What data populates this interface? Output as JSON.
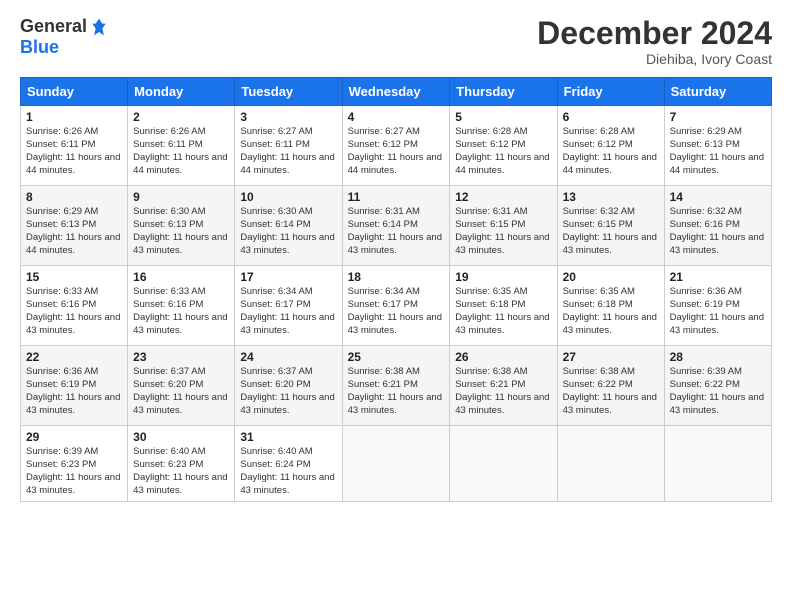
{
  "header": {
    "logo_general": "General",
    "logo_blue": "Blue",
    "title": "December 2024",
    "location": "Diehiba, Ivory Coast"
  },
  "weekdays": [
    "Sunday",
    "Monday",
    "Tuesday",
    "Wednesday",
    "Thursday",
    "Friday",
    "Saturday"
  ],
  "weeks": [
    [
      {
        "day": "1",
        "sunrise": "6:26 AM",
        "sunset": "6:11 PM",
        "daylight": "11 hours and 44 minutes."
      },
      {
        "day": "2",
        "sunrise": "6:26 AM",
        "sunset": "6:11 PM",
        "daylight": "11 hours and 44 minutes."
      },
      {
        "day": "3",
        "sunrise": "6:27 AM",
        "sunset": "6:11 PM",
        "daylight": "11 hours and 44 minutes."
      },
      {
        "day": "4",
        "sunrise": "6:27 AM",
        "sunset": "6:12 PM",
        "daylight": "11 hours and 44 minutes."
      },
      {
        "day": "5",
        "sunrise": "6:28 AM",
        "sunset": "6:12 PM",
        "daylight": "11 hours and 44 minutes."
      },
      {
        "day": "6",
        "sunrise": "6:28 AM",
        "sunset": "6:12 PM",
        "daylight": "11 hours and 44 minutes."
      },
      {
        "day": "7",
        "sunrise": "6:29 AM",
        "sunset": "6:13 PM",
        "daylight": "11 hours and 44 minutes."
      }
    ],
    [
      {
        "day": "8",
        "sunrise": "6:29 AM",
        "sunset": "6:13 PM",
        "daylight": "11 hours and 44 minutes."
      },
      {
        "day": "9",
        "sunrise": "6:30 AM",
        "sunset": "6:13 PM",
        "daylight": "11 hours and 43 minutes."
      },
      {
        "day": "10",
        "sunrise": "6:30 AM",
        "sunset": "6:14 PM",
        "daylight": "11 hours and 43 minutes."
      },
      {
        "day": "11",
        "sunrise": "6:31 AM",
        "sunset": "6:14 PM",
        "daylight": "11 hours and 43 minutes."
      },
      {
        "day": "12",
        "sunrise": "6:31 AM",
        "sunset": "6:15 PM",
        "daylight": "11 hours and 43 minutes."
      },
      {
        "day": "13",
        "sunrise": "6:32 AM",
        "sunset": "6:15 PM",
        "daylight": "11 hours and 43 minutes."
      },
      {
        "day": "14",
        "sunrise": "6:32 AM",
        "sunset": "6:16 PM",
        "daylight": "11 hours and 43 minutes."
      }
    ],
    [
      {
        "day": "15",
        "sunrise": "6:33 AM",
        "sunset": "6:16 PM",
        "daylight": "11 hours and 43 minutes."
      },
      {
        "day": "16",
        "sunrise": "6:33 AM",
        "sunset": "6:16 PM",
        "daylight": "11 hours and 43 minutes."
      },
      {
        "day": "17",
        "sunrise": "6:34 AM",
        "sunset": "6:17 PM",
        "daylight": "11 hours and 43 minutes."
      },
      {
        "day": "18",
        "sunrise": "6:34 AM",
        "sunset": "6:17 PM",
        "daylight": "11 hours and 43 minutes."
      },
      {
        "day": "19",
        "sunrise": "6:35 AM",
        "sunset": "6:18 PM",
        "daylight": "11 hours and 43 minutes."
      },
      {
        "day": "20",
        "sunrise": "6:35 AM",
        "sunset": "6:18 PM",
        "daylight": "11 hours and 43 minutes."
      },
      {
        "day": "21",
        "sunrise": "6:36 AM",
        "sunset": "6:19 PM",
        "daylight": "11 hours and 43 minutes."
      }
    ],
    [
      {
        "day": "22",
        "sunrise": "6:36 AM",
        "sunset": "6:19 PM",
        "daylight": "11 hours and 43 minutes."
      },
      {
        "day": "23",
        "sunrise": "6:37 AM",
        "sunset": "6:20 PM",
        "daylight": "11 hours and 43 minutes."
      },
      {
        "day": "24",
        "sunrise": "6:37 AM",
        "sunset": "6:20 PM",
        "daylight": "11 hours and 43 minutes."
      },
      {
        "day": "25",
        "sunrise": "6:38 AM",
        "sunset": "6:21 PM",
        "daylight": "11 hours and 43 minutes."
      },
      {
        "day": "26",
        "sunrise": "6:38 AM",
        "sunset": "6:21 PM",
        "daylight": "11 hours and 43 minutes."
      },
      {
        "day": "27",
        "sunrise": "6:38 AM",
        "sunset": "6:22 PM",
        "daylight": "11 hours and 43 minutes."
      },
      {
        "day": "28",
        "sunrise": "6:39 AM",
        "sunset": "6:22 PM",
        "daylight": "11 hours and 43 minutes."
      }
    ],
    [
      {
        "day": "29",
        "sunrise": "6:39 AM",
        "sunset": "6:23 PM",
        "daylight": "11 hours and 43 minutes."
      },
      {
        "day": "30",
        "sunrise": "6:40 AM",
        "sunset": "6:23 PM",
        "daylight": "11 hours and 43 minutes."
      },
      {
        "day": "31",
        "sunrise": "6:40 AM",
        "sunset": "6:24 PM",
        "daylight": "11 hours and 43 minutes."
      },
      null,
      null,
      null,
      null
    ]
  ]
}
